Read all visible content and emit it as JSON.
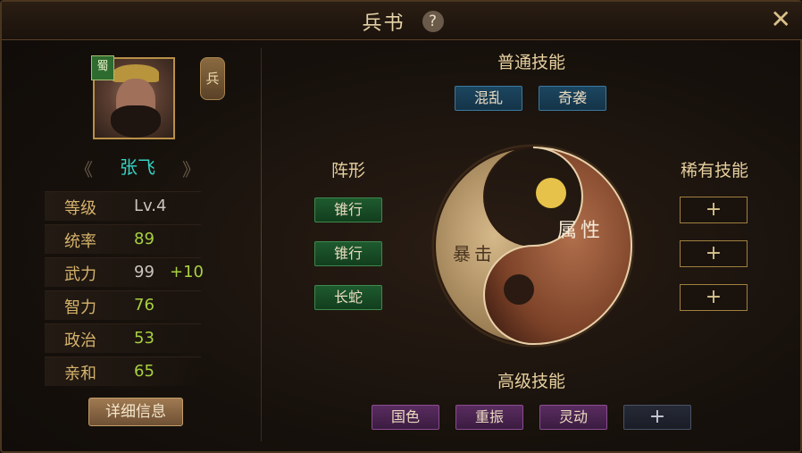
{
  "window": {
    "title": "兵书",
    "help_label": "?",
    "close_label": "✕"
  },
  "general": {
    "faction_badge": "蜀",
    "type_tag": "兵",
    "name": "张飞",
    "prev_arrow": "《",
    "next_arrow": "》",
    "stats": [
      {
        "label": "等级",
        "value": "Lv.4",
        "bonus": "",
        "color": "#c8c4bc"
      },
      {
        "label": "统率",
        "value": "89",
        "bonus": "",
        "color": "#a8d040"
      },
      {
        "label": "武力",
        "value": "99",
        "bonus": "+10",
        "color": "#c8c4bc"
      },
      {
        "label": "智力",
        "value": "76",
        "bonus": "",
        "color": "#a8d040"
      },
      {
        "label": "政治",
        "value": "53",
        "bonus": "",
        "color": "#a8d040"
      },
      {
        "label": "亲和",
        "value": "65",
        "bonus": "",
        "color": "#a8d040"
      }
    ],
    "detail_button": "详细信息"
  },
  "normal_skills": {
    "title": "普通技能",
    "items": [
      "混乱",
      "奇袭"
    ]
  },
  "formation": {
    "title": "阵形",
    "items": [
      "锥行",
      "锥行",
      "长蛇"
    ]
  },
  "yinyang": {
    "dark_label": "暴击",
    "light_label": "属性"
  },
  "rare_skills": {
    "title": "稀有技能",
    "slots": [
      "+",
      "+",
      "+"
    ]
  },
  "advanced_skills": {
    "title": "高级技能",
    "items": [
      "国色",
      "重振",
      "灵动"
    ],
    "empty_slot": "+"
  },
  "colors": {
    "accent": "#e6cf9e",
    "name": "#36d2c4",
    "good_value": "#a8d040",
    "border": "#4a3520"
  }
}
